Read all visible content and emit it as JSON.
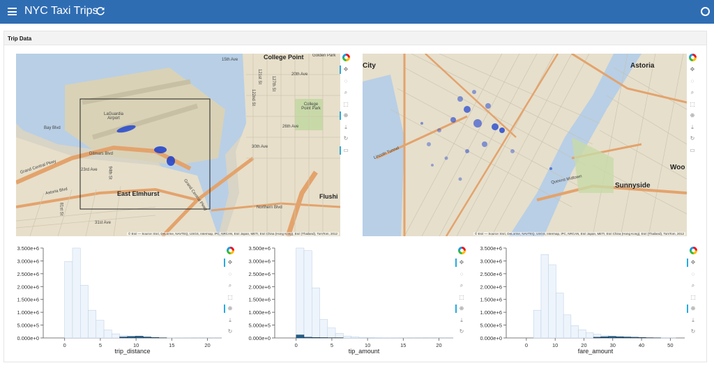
{
  "header": {
    "title": "NYC Taxi Trips",
    "menu_icon": "hamburger-icon",
    "reload_icon": "reload-icon",
    "status_icon": "busy-indicator-icon",
    "color": "#2f6db3"
  },
  "card": {
    "title": "Trip Data"
  },
  "maps": {
    "attribution": "© Esri — Source: Esri, DeLorme, NAVTEQ, USGS, Intermap, iPC, NRCAN, Esri Japan, METI, Esri China (Hong Kong), Esri (Thailand), TomTom, 2012",
    "left": {
      "labels": [
        "College Point",
        "Golden Park",
        "15th Ave",
        "20th Ave",
        "LaGuardia Airport",
        "College Point Park",
        "26th Ave",
        "30th Ave",
        "Ditmars Blvd",
        "23rd Ave",
        "Astoria Blvd",
        "East Elmhurst",
        "Grand Central Pkwy",
        "Flushi",
        "Bay Blvd",
        "31st Ave",
        "Northern Blvd",
        "122nd St",
        "121st St",
        "127th St",
        "81st St",
        "94th St",
        "Grand Central Pkwy"
      ]
    },
    "right": {
      "labels": [
        "City",
        "Astoria",
        "Sunnyside",
        "Woo",
        "Lincoln Tunnel",
        "Queens Midtown"
      ]
    }
  },
  "toolbar": {
    "tools": [
      "pan-icon",
      "lasso-icon",
      "box-zoom-icon",
      "box-select-icon",
      "wheel-zoom-icon",
      "save-icon",
      "reset-icon",
      "hover-icon"
    ]
  },
  "chart_data": [
    {
      "type": "bar",
      "xlabel": "trip_distance",
      "x_ticks": [
        0,
        5,
        10,
        15,
        20
      ],
      "y_ticks": [
        "0.000e+0",
        "5.000e+5",
        "1.000e+6",
        "1.500e+6",
        "2.000e+6",
        "2.500e+6",
        "3.000e+6",
        "3.500e+6"
      ],
      "xlim": [
        -3,
        22
      ],
      "ylim": [
        0,
        3500000
      ],
      "bin_width": 1.1,
      "bin_start": 0,
      "values": [
        2980000,
        3550000,
        2050000,
        1080000,
        690000,
        310000,
        160000,
        90000,
        55000,
        35000,
        20000,
        12000,
        8000,
        5000,
        3000,
        2000,
        1000,
        800,
        500,
        300
      ],
      "selected_values": [
        0,
        0,
        0,
        0,
        0,
        0,
        0,
        40000,
        60000,
        70000,
        40000,
        20000,
        8000,
        0,
        0,
        0,
        0,
        0,
        0,
        0
      ]
    },
    {
      "type": "bar",
      "xlabel": "tip_amount",
      "x_ticks": [
        0,
        5,
        10,
        15,
        20
      ],
      "y_ticks": [
        "0.000e+0",
        "5.000e+5",
        "1.000e+6",
        "1.500e+6",
        "2.000e+6",
        "2.500e+6",
        "3.000e+6",
        "3.500e+6"
      ],
      "xlim": [
        -3,
        22
      ],
      "ylim": [
        0,
        3500000
      ],
      "bin_width": 1.1,
      "bin_start": 0,
      "values": [
        4050000,
        3400000,
        1950000,
        720000,
        390000,
        180000,
        70000,
        40000,
        25000,
        15000,
        10000,
        7000,
        4000,
        2500,
        1500,
        1000,
        600,
        400,
        300,
        200
      ],
      "selected_values": [
        120000,
        30000,
        20000,
        15000,
        10000,
        10000,
        0,
        0,
        0,
        0,
        0,
        0,
        0,
        0,
        0,
        0,
        0,
        0,
        0,
        0
      ]
    },
    {
      "type": "bar",
      "xlabel": "fare_amount",
      "x_ticks": [
        0,
        10,
        20,
        30,
        40,
        50
      ],
      "y_ticks": [
        "0.000e+0",
        "5.000e+5",
        "1.000e+6",
        "1.500e+6",
        "2.000e+6",
        "2.500e+6",
        "3.000e+6",
        "3.500e+6"
      ],
      "xlim": [
        -7,
        55
      ],
      "ylim": [
        0,
        3500000
      ],
      "bin_width": 2.6,
      "bin_start": 2.5,
      "values": [
        1080000,
        3250000,
        2850000,
        1750000,
        900000,
        480000,
        320000,
        200000,
        140000,
        100000,
        70000,
        50000,
        30000,
        20000,
        12000,
        8000,
        5000,
        3000,
        2000
      ],
      "selected_values": [
        0,
        0,
        0,
        0,
        0,
        0,
        0,
        0,
        30000,
        50000,
        60000,
        50000,
        40000,
        30000,
        20000,
        10000,
        5000,
        0,
        0
      ]
    }
  ]
}
